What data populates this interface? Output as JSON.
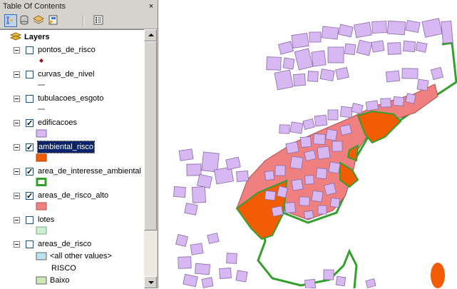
{
  "toc": {
    "title": "Table Of Contents",
    "close_glyph": "×",
    "root_label": "Layers",
    "layers": [
      {
        "name": "pontos_de_risco",
        "checked": false,
        "symbol": "point",
        "color": "#8b1a1a"
      },
      {
        "name": "curvas_de_nivel",
        "checked": false,
        "symbol": "line",
        "color": "#555555"
      },
      {
        "name": "tubulacoes_esgoto",
        "checked": false,
        "symbol": "line",
        "color": "#555555"
      },
      {
        "name": "edificacoes",
        "checked": true,
        "symbol": "fill",
        "color": "#d7b8f2",
        "outline": "#8c6ca8"
      },
      {
        "name": "ambiental_risco",
        "checked": true,
        "selected": true,
        "symbol": "fill",
        "color": "#f25c05",
        "outline": "#b34000"
      },
      {
        "name": "area_de_interesse_ambiental",
        "checked": true,
        "symbol": "hollow",
        "color": "#33a02c"
      },
      {
        "name": "areas_de_risco_alto",
        "checked": true,
        "symbol": "fill",
        "color": "#f08080",
        "outline": "#b05050"
      },
      {
        "name": "lotes",
        "checked": false,
        "symbol": "fill",
        "color": "#cdeed3",
        "outline": "#7aa882"
      },
      {
        "name": "areas_de_risco",
        "checked": false,
        "symbol": "none"
      }
    ],
    "sublegend": {
      "all_other_values": "<all other values>",
      "all_other_color": "#bde3f2",
      "field": "RISCO",
      "first_class": "Baixo",
      "first_class_color": "#cde8b4"
    }
  },
  "map": {
    "building_color": "#d7b8f2",
    "building_outline": "#8a6aa6",
    "high_risk_color": "#f08080",
    "env_risk_color": "#f25c05",
    "interest_outline": "#33a02c"
  }
}
